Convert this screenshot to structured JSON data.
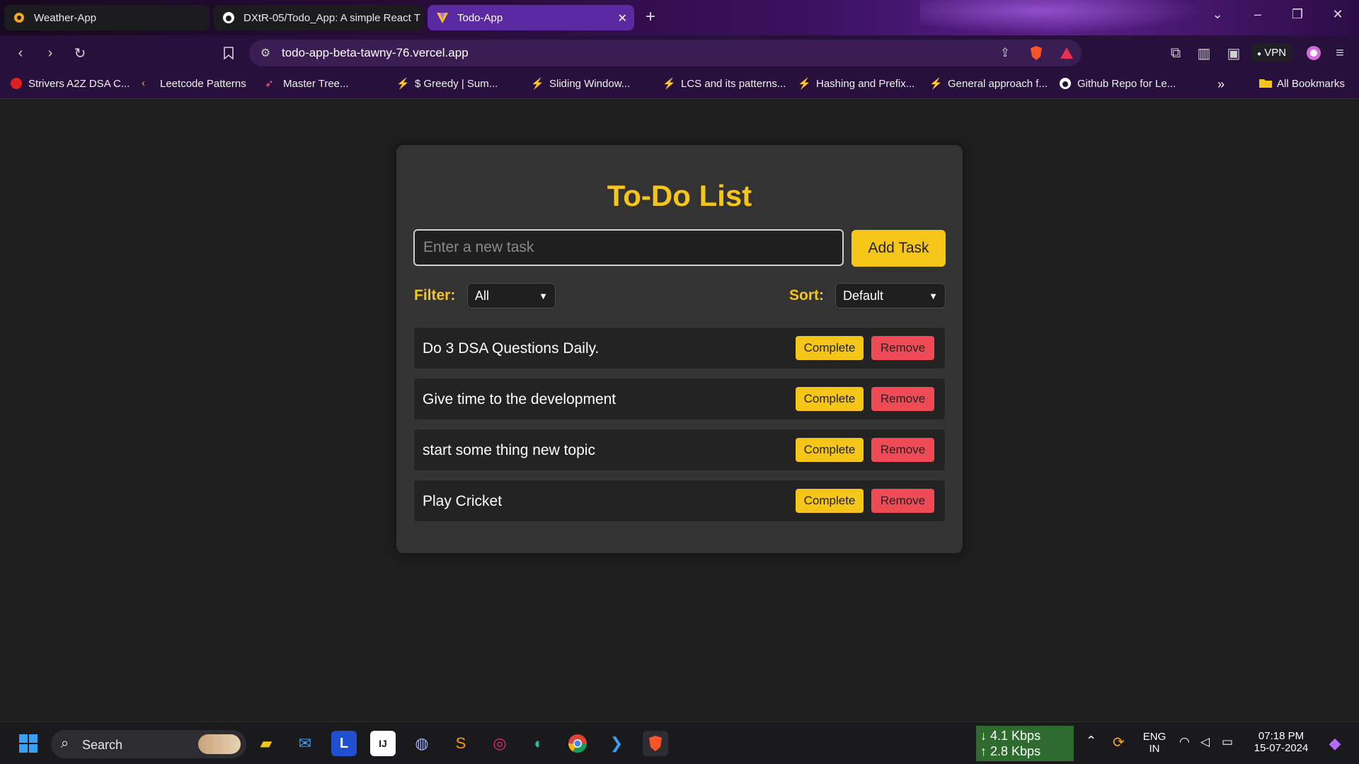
{
  "browser": {
    "tabs": [
      {
        "title": "Weather-App",
        "icon": "weather-favicon"
      },
      {
        "title": "DXtR-05/Todo_App: A simple React T",
        "icon": "github-icon"
      },
      {
        "title": "Todo-App",
        "icon": "vite-icon",
        "active": true
      }
    ],
    "url": "todo-app-beta-tawny-76.vercel.app",
    "vpn_label": "VPN",
    "bookmarks": [
      "Strivers A2Z DSA C...",
      "Leetcode Patterns",
      "Master Tree...",
      "$ Greedy | Sum...",
      "Sliding Window...",
      "LCS and its patterns...",
      "Hashing and Prefix...",
      "General approach f...",
      "Github Repo for Le...",
      "All Bookmarks"
    ]
  },
  "app": {
    "title": "To-Do List",
    "input_placeholder": "Enter a new task",
    "add_button": "Add Task",
    "filter_label": "Filter:",
    "filter_value": "All",
    "sort_label": "Sort:",
    "sort_value": "Default",
    "complete_label": "Complete",
    "remove_label": "Remove",
    "tasks": [
      {
        "text": "Do 3 DSA Questions Daily."
      },
      {
        "text": "Give time to the development"
      },
      {
        "text": "start some thing new topic"
      },
      {
        "text": "Play Cricket"
      }
    ]
  },
  "taskbar": {
    "search_label": "Search",
    "net_down": "4.1 Kbps",
    "net_up": "2.8 Kbps",
    "lang_1": "ENG",
    "lang_2": "IN",
    "time": "07:18 PM",
    "date": "15-07-2024"
  },
  "colors": {
    "accent_yellow": "#f5c518",
    "remove_red": "#f04a56",
    "card_bg": "#333333",
    "page_bg": "#1e1e1e"
  }
}
